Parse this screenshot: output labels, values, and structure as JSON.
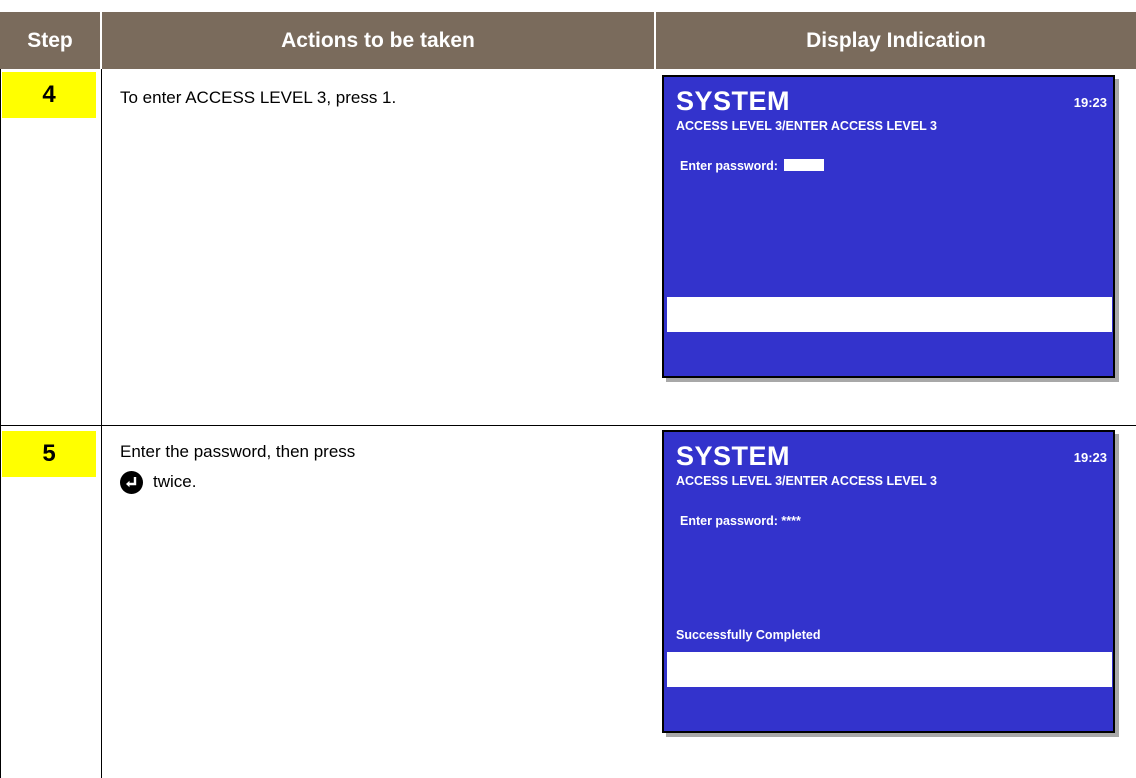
{
  "header": {
    "step": "Step",
    "actions": "Actions to be taken",
    "display": "Display Indication"
  },
  "rows": [
    {
      "step": "4",
      "action_line1": "To enter ACCESS LEVEL 3, press 1.",
      "action_line2": "",
      "screen": {
        "title": "SYSTEM",
        "time": "19:23",
        "path": "ACCESS LEVEL 3/ENTER ACCESS LEVEL 3",
        "prompt": "Enter password:",
        "input_value": "",
        "message": ""
      }
    },
    {
      "step": "5",
      "action_line1": "Enter the password, then press",
      "action_line2": "twice.",
      "action_icon": "enter-key-icon",
      "screen": {
        "title": "SYSTEM",
        "time": "19:23",
        "path": "ACCESS LEVEL 3/ENTER ACCESS LEVEL 3",
        "prompt": "Enter password:",
        "input_value": "****",
        "message": "Successfully Completed"
      }
    }
  ],
  "colors": {
    "header_bg": "#7a6b5c",
    "step_badge": "#ffff00",
    "screen_bg": "#3333cc"
  }
}
